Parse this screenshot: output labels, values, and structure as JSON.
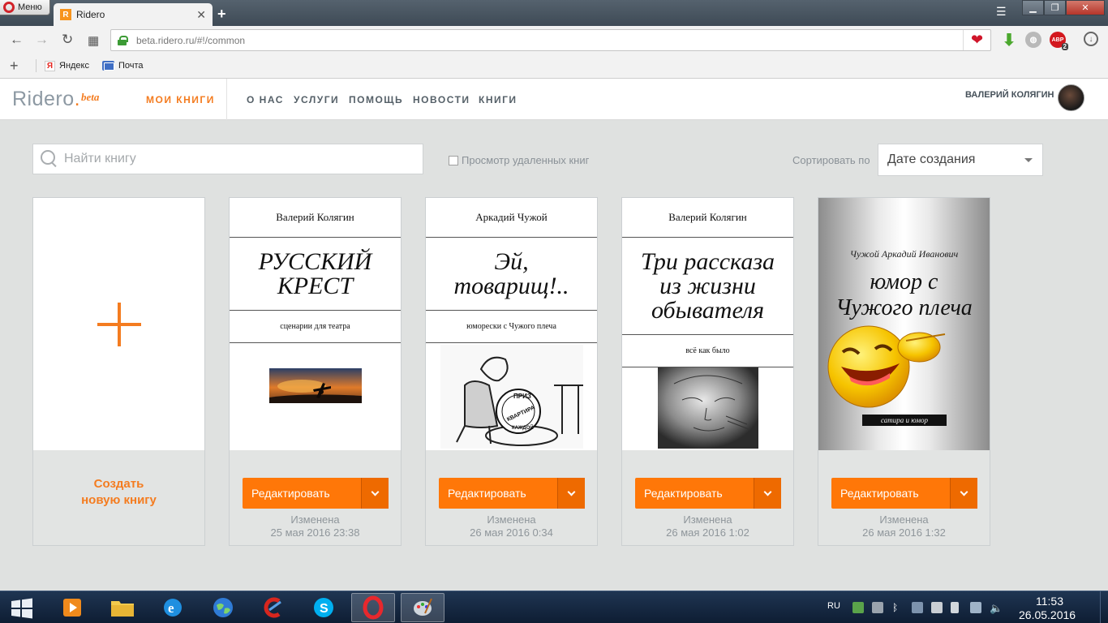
{
  "browser": {
    "menu_label": "Меню",
    "tab_title": "Ridero",
    "tab_favicon": "R",
    "new_tab": "+",
    "url": "beta.ridero.ru/#!/common",
    "bookmarks": [
      {
        "label": "Яндекс",
        "icon": "yandex-icon"
      },
      {
        "label": "Почта",
        "icon": "mail-icon"
      }
    ],
    "abp_label": "ABP",
    "abp_badge": "2"
  },
  "header": {
    "logo": "Ridero",
    "logo_dot": ".",
    "logo_beta": "beta",
    "my_books": "МОИ КНИГИ",
    "nav": [
      "О НАС",
      "УСЛУГИ",
      "ПОМОЩЬ",
      "НОВОСТИ",
      "КНИГИ"
    ],
    "user_name": "ВАЛЕРИЙ КОЛЯГИН"
  },
  "toolbar": {
    "search_placeholder": "Найти книгу",
    "deleted_label": "Просмотр удаленных книг",
    "sort_label": "Сортировать по",
    "sort_value": "Дате создания"
  },
  "create": {
    "line1": "Создать",
    "line2": "новую книгу"
  },
  "books": [
    {
      "author": "Валерий Колягин",
      "title": "РУССКИЙ КРЕСТ",
      "subtitle": "сценарии для театра",
      "edit_label": "Редактировать",
      "changed_label": "Изменена",
      "changed_date": "25 мая 2016 23:38"
    },
    {
      "author": "Аркадий Чужой",
      "title": "Эй, товарищ!..",
      "subtitle": "юморески с Чужого плеча",
      "edit_label": "Редактировать",
      "changed_label": "Изменена",
      "changed_date": "26 мая 2016 0:34",
      "illustration_text": [
        "ПРИЗ",
        "КВАРТИРА",
        "КАЖДОЙ"
      ]
    },
    {
      "author": "Валерий Колягин",
      "title": "Три рассказа из жизни обывателя",
      "subtitle": "всё как было",
      "edit_label": "Редактировать",
      "changed_label": "Изменена",
      "changed_date": "26 мая 2016 1:02"
    },
    {
      "author": "Чужой Аркадий Иванович",
      "title": "юмор с Чужого плеча",
      "subtitle": "сатира и юмор",
      "edit_label": "Редактировать",
      "changed_label": "Изменена",
      "changed_date": "26 мая 2016 1:32"
    }
  ],
  "taskbar": {
    "lang": "RU",
    "time": "11:53",
    "date": "26.05.2016"
  },
  "colors": {
    "accent": "#f47c20",
    "button": "#ff7708",
    "background": "#dfe1e0"
  }
}
